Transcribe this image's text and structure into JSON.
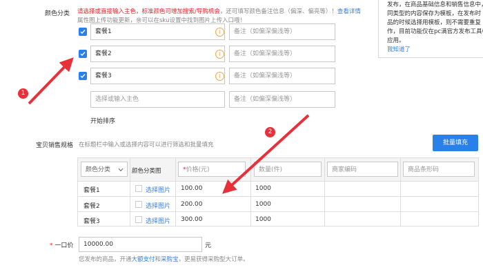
{
  "color_section": {
    "label": "颜色分类",
    "hint_red": "请选择或直接输入主色，标准颜色可增加搜索/导购机会",
    "hint_rest": "，还可填写颜色备注信息（偏深、偏亮等）！",
    "hint_link": "查看详情",
    "hint2": "属性图上传功能更新，亲可以在sku设置中找到图片上传入口哦！",
    "items": [
      {
        "name": "套餐1",
        "checked": true
      },
      {
        "name": "套餐2",
        "checked": true
      },
      {
        "name": "套餐3",
        "checked": true
      }
    ],
    "note_placeholder": "备注（如偏深偏浅等）",
    "new_placeholder": "选择或输入主色",
    "sort_label": "开始排序",
    "info_glyph": "i"
  },
  "tooltip": {
    "lines": [
      "发布，在商品基础信息和销售信息中，",
      "同类型的内容保存为模板，在发布时",
      "品的时候选择用模板，则不需要重复",
      "作，目前功能仅在pc满官方发布工具中",
      "应用。"
    ],
    "ok": "我知道了"
  },
  "annotations": {
    "m1": "1",
    "m2": "2"
  },
  "sku_section": {
    "label": "宝贝销售规格",
    "hint": "在标题栏中输入或选择内容可以进行筛选和批量填充",
    "batch_button": "批量填充",
    "headers": {
      "color": "颜色分类",
      "image": "颜色分类图",
      "price": "价格(元)",
      "qty": "数量(件)",
      "code": "商家编码",
      "barcode": "商品条形码"
    },
    "price_required_mark": "*",
    "select_image": "选择图片",
    "rows": [
      {
        "name": "套餐1",
        "price": "100.00",
        "qty": "1000"
      },
      {
        "name": "套餐2",
        "price": "200.00",
        "qty": "1000"
      },
      {
        "name": "套餐3",
        "price": "300.00",
        "qty": "1000"
      }
    ]
  },
  "price_section": {
    "required_mark": "*",
    "label": "一口价",
    "value": "10000.00",
    "unit": "元",
    "hint_a": "您发布的商品，开通",
    "link_a": "大额支付",
    "hint_b": "和",
    "link_b": "采购宝",
    "hint_c": "，更易获得采购型大订单。"
  },
  "colors": {
    "accent": "#2a80e9",
    "red": "#e5242b",
    "annotation": "#e8303a"
  }
}
